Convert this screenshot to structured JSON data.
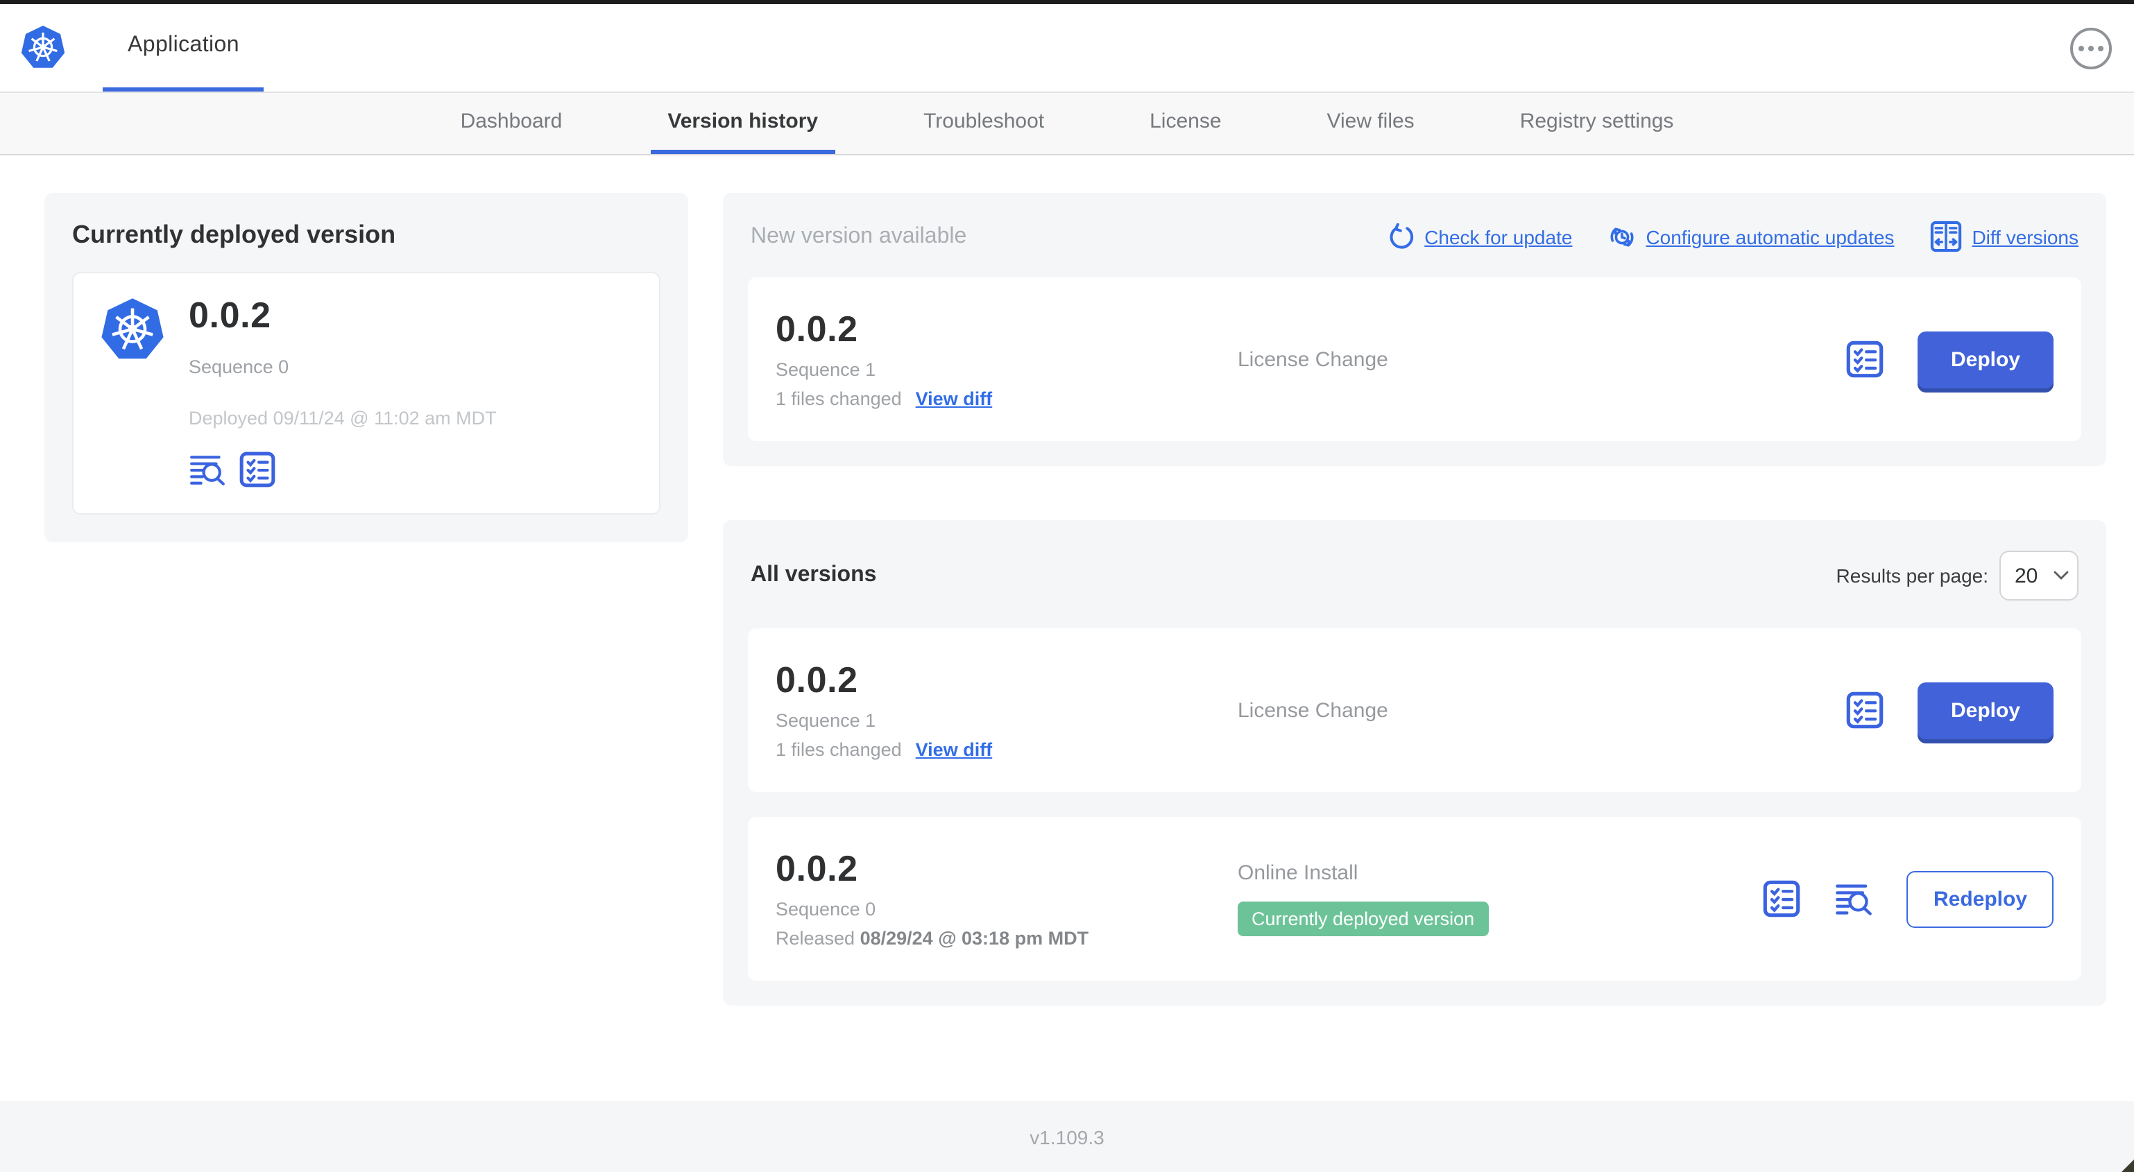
{
  "app": {
    "title": "Application"
  },
  "nav": {
    "tabs": [
      {
        "label": "Dashboard",
        "active": false
      },
      {
        "label": "Version history",
        "active": true
      },
      {
        "label": "Troubleshoot",
        "active": false
      },
      {
        "label": "License",
        "active": false
      },
      {
        "label": "View files",
        "active": false
      },
      {
        "label": "Registry settings",
        "active": false
      }
    ]
  },
  "current_deployed": {
    "heading": "Currently deployed version",
    "version": "0.0.2",
    "sequence": "Sequence 0",
    "deployed": "Deployed 09/11/24 @ 11:02 am MDT"
  },
  "new_version": {
    "heading": "New version available",
    "actions": {
      "check": "Check for update",
      "configure": "Configure automatic updates",
      "diff": "Diff versions"
    },
    "row": {
      "version": "0.0.2",
      "sequence": "Sequence 1",
      "files_changed": "1 files changed",
      "view_diff": "View diff",
      "source": "License Change",
      "action": "Deploy"
    }
  },
  "all_versions": {
    "heading": "All versions",
    "results_per_page_label": "Results per page:",
    "results_per_page_value": "20",
    "rows": {
      "0": {
        "version": "0.0.2",
        "sequence": "Sequence 1",
        "files_changed": "1 files changed",
        "view_diff": "View diff",
        "source": "License Change",
        "action": "Deploy"
      },
      "1": {
        "version": "0.0.2",
        "sequence": "Sequence 0",
        "released_prefix": "Released ",
        "released_date": "08/29/24 @ 03:18 pm MDT",
        "source": "Online Install",
        "badge": "Currently deployed version",
        "action": "Redeploy"
      }
    }
  },
  "footer": {
    "version": "v1.109.3"
  },
  "colors": {
    "accent_blue": "#3b6ae0",
    "link_blue": "#326de6",
    "button_blue": "#4262d9",
    "badge_green": "#6cc398",
    "panel_gray": "#f5f6f8",
    "logo_blue": "#326ce5"
  }
}
